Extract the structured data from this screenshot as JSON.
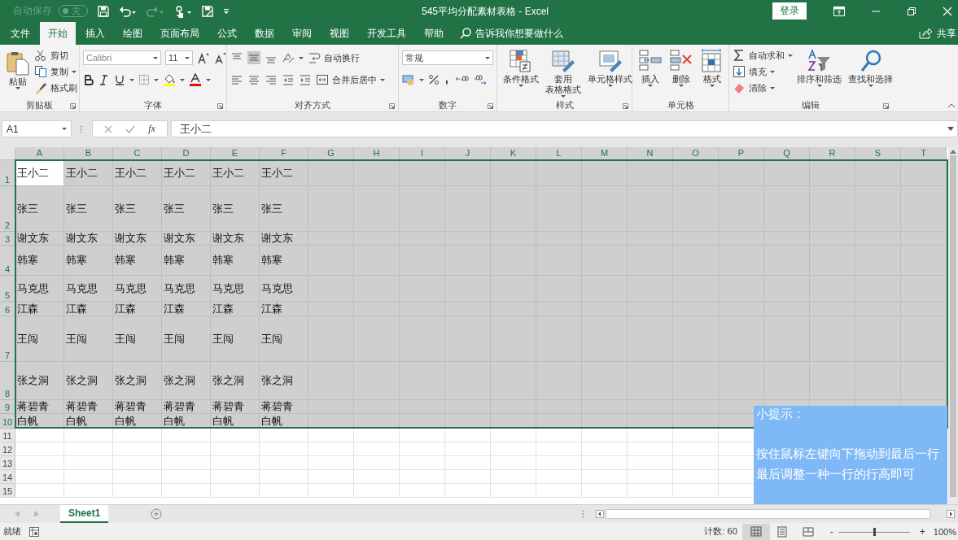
{
  "title_bar": {
    "autosave_label": "自动保存",
    "autosave_on": false,
    "autosave_state": "关",
    "title": "545平均分配素材表格  -  Excel",
    "login": "登录"
  },
  "menu_tabs": [
    {
      "label": "文件",
      "selected": false
    },
    {
      "label": "开始",
      "selected": true
    },
    {
      "label": "插入",
      "selected": false
    },
    {
      "label": "绘图",
      "selected": false
    },
    {
      "label": "页面布局",
      "selected": false
    },
    {
      "label": "公式",
      "selected": false
    },
    {
      "label": "数据",
      "selected": false
    },
    {
      "label": "审阅",
      "selected": false
    },
    {
      "label": "视图",
      "selected": false
    },
    {
      "label": "开发工具",
      "selected": false
    },
    {
      "label": "帮助",
      "selected": false
    }
  ],
  "tell_me": "告诉我你想要做什么",
  "share": "共享",
  "ribbon": [
    {
      "kind": "clipboard",
      "label": "剪贴板",
      "paste": "粘贴",
      "small": [
        "剪切",
        "复制",
        "格式刷"
      ]
    },
    {
      "kind": "font",
      "label": "字体",
      "font_name": "Calibri",
      "font_size": "11"
    },
    {
      "kind": "alignment",
      "label": "对齐方式",
      "vertical": [
        {
          "selected": false
        },
        {
          "selected": true
        },
        {
          "selected": false
        }
      ],
      "wrap": "自动换行",
      "merge": "合并后居中"
    },
    {
      "kind": "number",
      "label": "数字",
      "format": "常规"
    },
    {
      "kind": "large",
      "label": "样式",
      "buttons": [
        {
          "label": "条件格式"
        },
        {
          "label": "套用",
          "label_2": "表格格式"
        },
        {
          "label": "单元格样式"
        }
      ]
    },
    {
      "kind": "large",
      "label": "单元格",
      "buttons": [
        {
          "label": "插入"
        },
        {
          "label": "删除"
        },
        {
          "label": "格式"
        }
      ]
    },
    {
      "kind": "editing",
      "label": "编辑",
      "small": [
        "自动求和",
        "填充",
        "清除"
      ],
      "buttons": [
        {
          "label": "排序和筛选"
        },
        {
          "label": "查找和选择"
        }
      ]
    }
  ],
  "formula_bar": {
    "name_box": "A1",
    "fx": "fx",
    "content": "王小二"
  },
  "columns": [
    "A",
    "B",
    "C",
    "D",
    "E",
    "F",
    "G",
    "H",
    "I",
    "J",
    "K",
    "L",
    "M",
    "N",
    "O",
    "P",
    "Q",
    "R",
    "S",
    "T"
  ],
  "rows": [
    {
      "number": "1",
      "selected": true,
      "cells": [
        {
          "text": "王小二",
          "active": true
        },
        {
          "text": "王小二",
          "active": false
        },
        {
          "text": "王小二",
          "active": false
        },
        {
          "text": "王小二",
          "active": false
        },
        {
          "text": "王小二",
          "active": false
        },
        {
          "text": "王小二",
          "active": false
        }
      ]
    },
    {
      "number": "2",
      "selected": true,
      "cells": [
        {
          "text": "张三",
          "active": false
        },
        {
          "text": "张三",
          "active": false
        },
        {
          "text": "张三",
          "active": false
        },
        {
          "text": "张三",
          "active": false
        },
        {
          "text": "张三",
          "active": false
        },
        {
          "text": "张三",
          "active": false
        }
      ]
    },
    {
      "number": "3",
      "selected": true,
      "cells": [
        {
          "text": "谢文东",
          "active": false
        },
        {
          "text": "谢文东",
          "active": false
        },
        {
          "text": "谢文东",
          "active": false
        },
        {
          "text": "谢文东",
          "active": false
        },
        {
          "text": "谢文东",
          "active": false
        },
        {
          "text": "谢文东",
          "active": false
        }
      ]
    },
    {
      "number": "4",
      "selected": true,
      "cells": [
        {
          "text": "韩寒",
          "active": false
        },
        {
          "text": "韩寒",
          "active": false
        },
        {
          "text": "韩寒",
          "active": false
        },
        {
          "text": "韩寒",
          "active": false
        },
        {
          "text": "韩寒",
          "active": false
        },
        {
          "text": "韩寒",
          "active": false
        }
      ]
    },
    {
      "number": "5",
      "selected": true,
      "cells": [
        {
          "text": "马克思",
          "active": false
        },
        {
          "text": "马克思",
          "active": false
        },
        {
          "text": "马克思",
          "active": false
        },
        {
          "text": "马克思",
          "active": false
        },
        {
          "text": "马克思",
          "active": false
        },
        {
          "text": "马克思",
          "active": false
        }
      ]
    },
    {
      "number": "6",
      "selected": true,
      "cells": [
        {
          "text": "江森",
          "active": false
        },
        {
          "text": "江森",
          "active": false
        },
        {
          "text": "江森",
          "active": false
        },
        {
          "text": "江森",
          "active": false
        },
        {
          "text": "江森",
          "active": false
        },
        {
          "text": "江森",
          "active": false
        }
      ]
    },
    {
      "number": "7",
      "selected": true,
      "cells": [
        {
          "text": "王闯",
          "active": false
        },
        {
          "text": "王闯",
          "active": false
        },
        {
          "text": "王闯",
          "active": false
        },
        {
          "text": "王闯",
          "active": false
        },
        {
          "text": "王闯",
          "active": false
        },
        {
          "text": "王闯",
          "active": false
        }
      ]
    },
    {
      "number": "8",
      "selected": true,
      "cells": [
        {
          "text": "张之洞",
          "active": false
        },
        {
          "text": "张之洞",
          "active": false
        },
        {
          "text": "张之洞",
          "active": false
        },
        {
          "text": "张之洞",
          "active": false
        },
        {
          "text": "张之洞",
          "active": false
        },
        {
          "text": "张之洞",
          "active": false
        }
      ]
    },
    {
      "number": "9",
      "selected": true,
      "cells": [
        {
          "text": "蒋碧青",
          "active": false
        },
        {
          "text": "蒋碧青",
          "active": false
        },
        {
          "text": "蒋碧青",
          "active": false
        },
        {
          "text": "蒋碧青",
          "active": false
        },
        {
          "text": "蒋碧青",
          "active": false
        },
        {
          "text": "蒋碧青",
          "active": false
        }
      ]
    },
    {
      "number": "10",
      "selected": true,
      "cells": [
        {
          "text": "白帆",
          "active": false
        },
        {
          "text": "白帆",
          "active": false
        },
        {
          "text": "白帆",
          "active": false
        },
        {
          "text": "白帆",
          "active": false
        },
        {
          "text": "白帆",
          "active": false
        },
        {
          "text": "白帆",
          "active": false
        }
      ]
    },
    {
      "number": "11",
      "selected": false,
      "cells": []
    },
    {
      "number": "12",
      "selected": false,
      "cells": []
    },
    {
      "number": "13",
      "selected": false,
      "cells": []
    },
    {
      "number": "14",
      "selected": false,
      "cells": []
    },
    {
      "number": "15",
      "selected": false,
      "cells": []
    }
  ],
  "sheet_tabs": [
    {
      "label": "Sheet1",
      "selected": true
    }
  ],
  "status_bar": {
    "ready": "就绪",
    "count": "计数: 60",
    "zoom_minus": "-",
    "zoom_plus": "+",
    "zoom": {
      "level": 0.5
    },
    "zoom_text": "100%"
  },
  "tip": {
    "title": "小提示：",
    "lines": [
      "按住鼠标左键向下拖动到最后一行",
      "最后调整一种一行的行高即可"
    ]
  }
}
